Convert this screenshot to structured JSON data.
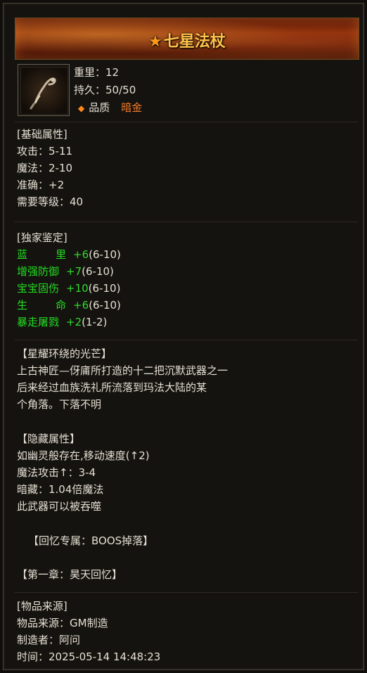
{
  "item": {
    "name": "七星法杖",
    "weight_label": "重里：",
    "weight": "12",
    "durability_label": "持久：",
    "durability": "50/50",
    "quality_label": "品质",
    "quality_value": "暗金",
    "quality_icon": "diamond-icon",
    "weapon_icon": "staff-icon"
  },
  "basic": {
    "header": "[基础属性]",
    "rows": [
      {
        "label": "攻击：",
        "value": "5-11"
      },
      {
        "label": "魔法：",
        "value": "2-10"
      },
      {
        "label": "准确：",
        "value": "+2"
      },
      {
        "label": "需要等级：",
        "value": "40"
      }
    ]
  },
  "unique": {
    "header": "[独家鉴定]",
    "rows": [
      {
        "label_a": "蓝",
        "label_b": "里",
        "bonus": "+6",
        "range": "(6-10)"
      },
      {
        "label": "增强防御",
        "bonus": "+7",
        "range": "(6-10)"
      },
      {
        "label": "宝宝固伤",
        "bonus": "+10",
        "range": "(6-10)"
      },
      {
        "label_a": "生",
        "label_b": "命",
        "bonus": "+6",
        "range": "(6-10)"
      },
      {
        "label": "暴走屠戮",
        "bonus": "+2",
        "range": "(1-2)"
      }
    ]
  },
  "lore": {
    "header": "【星耀环绕的光芒】",
    "lines": [
      "上古神匠—伢庯所打造的十二把沉默武器之一",
      "后来经过血族洗礼所流落到玛法大陆的某",
      "个角落。下落不明"
    ]
  },
  "hidden": {
    "header": "【隐藏属性】",
    "line1": "如幽灵般存在,移动速度(↑2)",
    "line2": "魔法攻击↑：3-4",
    "line3": "暗藏：1.04倍魔法",
    "line4": "此武器可以被吞噬"
  },
  "memory": "【回忆专属：BOOS掉落】",
  "chapter": "【第一章：昊天回忆】",
  "source": {
    "header": "[物品来源]",
    "origin_label": "物品来源：",
    "origin_value": "GM制造",
    "maker_label": "制造者：",
    "maker_value": "阿问",
    "time_label": "时间：",
    "time_value": "2025-05-14 14:48:23"
  },
  "colors": {
    "header": "#39a8ff",
    "attribute_green": "#22dd22",
    "lore_red": "#ff5a2a",
    "section_magenta": "#ff3cff",
    "quality_orange": "#f07a2a",
    "source_yellow": "#ffea5a"
  }
}
